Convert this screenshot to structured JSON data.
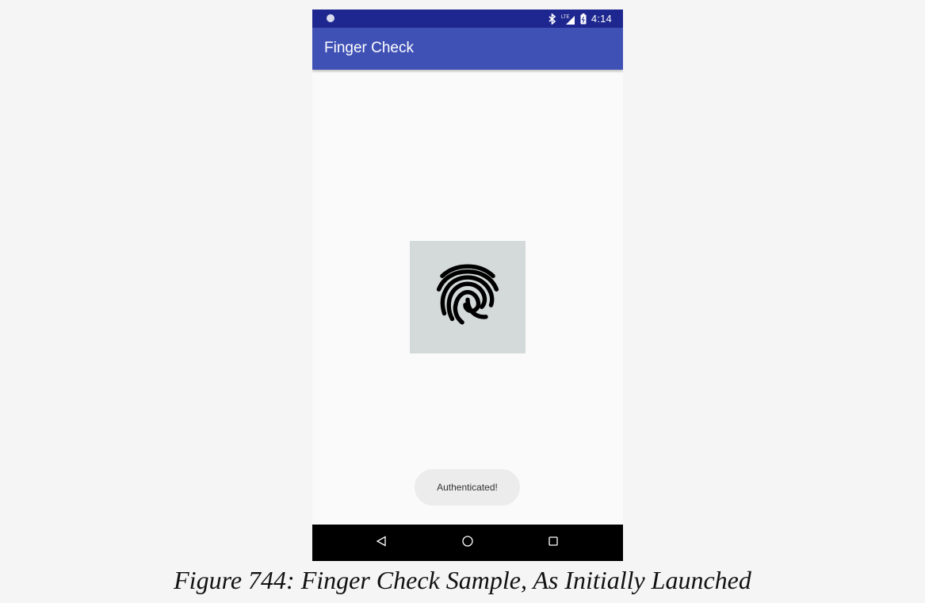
{
  "status_bar": {
    "time": "4:14",
    "icons": [
      "notification-dot-icon",
      "bluetooth-icon",
      "lte-signal-icon",
      "battery-icon"
    ]
  },
  "app_bar": {
    "title": "Finger Check"
  },
  "main": {
    "fingerprint_icon": "fingerprint-icon"
  },
  "toast": {
    "text": "Authenticated!"
  },
  "nav_bar": {
    "icons": [
      "back-icon",
      "home-icon",
      "recents-icon"
    ]
  },
  "caption": {
    "text": "Figure 744: Finger Check Sample, As Initially Launched"
  },
  "colors": {
    "status_bar": "#1e278f",
    "app_bar": "#3f51b5",
    "content_background": "#fafafa",
    "fingerprint_background": "#d4d9d9",
    "nav_bar": "#000000"
  }
}
